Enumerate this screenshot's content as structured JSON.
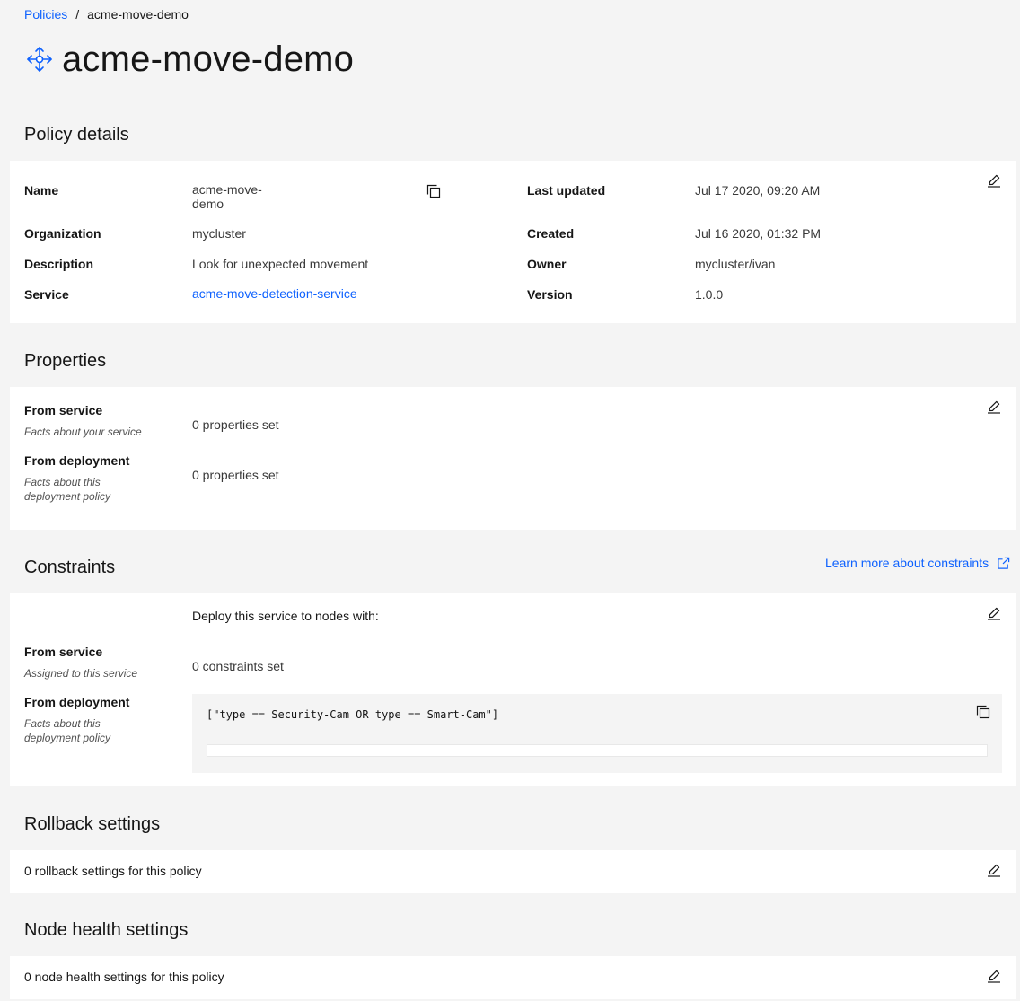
{
  "breadcrumb": {
    "parent": "Policies",
    "separator": "/",
    "current": "acme-move-demo"
  },
  "page": {
    "title": "acme-move-demo",
    "icon": "move-arrows-icon"
  },
  "policy_details": {
    "heading": "Policy details",
    "name_label": "Name",
    "name_value": "acme-move-\ndemo",
    "organization_label": "Organization",
    "organization_value": "mycluster",
    "description_label": "Description",
    "description_value": "Look for unexpected movement",
    "service_label": "Service",
    "service_value": "acme-move-detection-service",
    "last_updated_label": "Last updated",
    "last_updated_value": "Jul 17 2020, 09:20 AM",
    "created_label": "Created",
    "created_value": "Jul 16 2020, 01:32 PM",
    "owner_label": "Owner",
    "owner_value": "mycluster/ivan",
    "version_label": "Version",
    "version_value": "1.0.0"
  },
  "properties": {
    "heading": "Properties",
    "from_service_label": "From service",
    "from_service_helper": "Facts about your service",
    "from_service_value": "0 properties set",
    "from_deployment_label": "From deployment",
    "from_deployment_helper": "Facts about this deployment policy",
    "from_deployment_value": "0 properties set"
  },
  "constraints": {
    "heading": "Constraints",
    "learn_more": "Learn more about constraints",
    "intro": "Deploy this service to nodes with:",
    "from_service_label": "From service",
    "from_service_helper": "Assigned to this service",
    "from_service_value": "0 constraints set",
    "from_deployment_label": "From deployment",
    "from_deployment_helper": "Facts about this deployment policy",
    "code": "[\"type == Security-Cam OR type == Smart-Cam\"]"
  },
  "rollback": {
    "heading": "Rollback settings",
    "summary": "0 rollback settings for this policy"
  },
  "node_health": {
    "heading": "Node health settings",
    "summary": "0 node health settings for this policy"
  },
  "colors": {
    "background": "#f4f4f4",
    "card": "#ffffff",
    "link": "#0f62fe",
    "text": "#161616"
  }
}
